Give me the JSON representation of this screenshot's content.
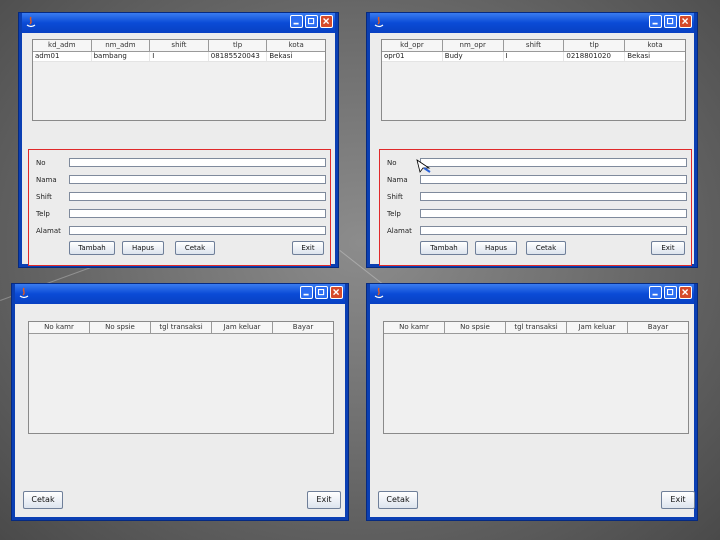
{
  "window_tl": {
    "table": {
      "columns": [
        "kd_adm",
        "nm_adm",
        "shift",
        "tlp",
        "kota"
      ],
      "rows": [
        [
          "adm01",
          "bambang",
          "I",
          "08185520043",
          "Bekasi"
        ]
      ]
    },
    "form": {
      "labels": [
        "No",
        "Nama",
        "Shift",
        "Telp",
        "Alamat"
      ],
      "buttons": [
        "Tambah",
        "Hapus",
        "Cetak",
        "Exit"
      ]
    }
  },
  "window_tr": {
    "table": {
      "columns": [
        "kd_opr",
        "nm_opr",
        "shift",
        "tlp",
        "kota"
      ],
      "rows": [
        [
          "opr01",
          "Budy",
          "I",
          "0218801020",
          "Bekasi"
        ]
      ]
    },
    "form": {
      "labels": [
        "No",
        "Nama",
        "Shift",
        "Telp",
        "Alamat"
      ],
      "buttons": [
        "Tambah",
        "Hapus",
        "Cetak",
        "Exit"
      ]
    }
  },
  "window_bl": {
    "table": {
      "columns": [
        "No kamr",
        "No spsie",
        "tgl transaksi",
        "Jam keluar",
        "Bayar"
      ]
    },
    "buttons": [
      "Cetak",
      "Exit"
    ]
  },
  "window_br": {
    "table": {
      "columns": [
        "No kamr",
        "No spsie",
        "tgl transaksi",
        "Jam keluar",
        "Bayar"
      ]
    },
    "buttons": [
      "Cetak",
      "Exit"
    ]
  },
  "colors": {
    "title_bar": "#0a4bd6",
    "window_border": "#0b3fb3",
    "close_button": "#d64a2a",
    "form_border": "#e0292a",
    "client_bg": "#ececec"
  },
  "icons": [
    "java-app-icon",
    "minimize-icon",
    "maximize-icon",
    "close-icon",
    "mouse-pointer-icon"
  ]
}
